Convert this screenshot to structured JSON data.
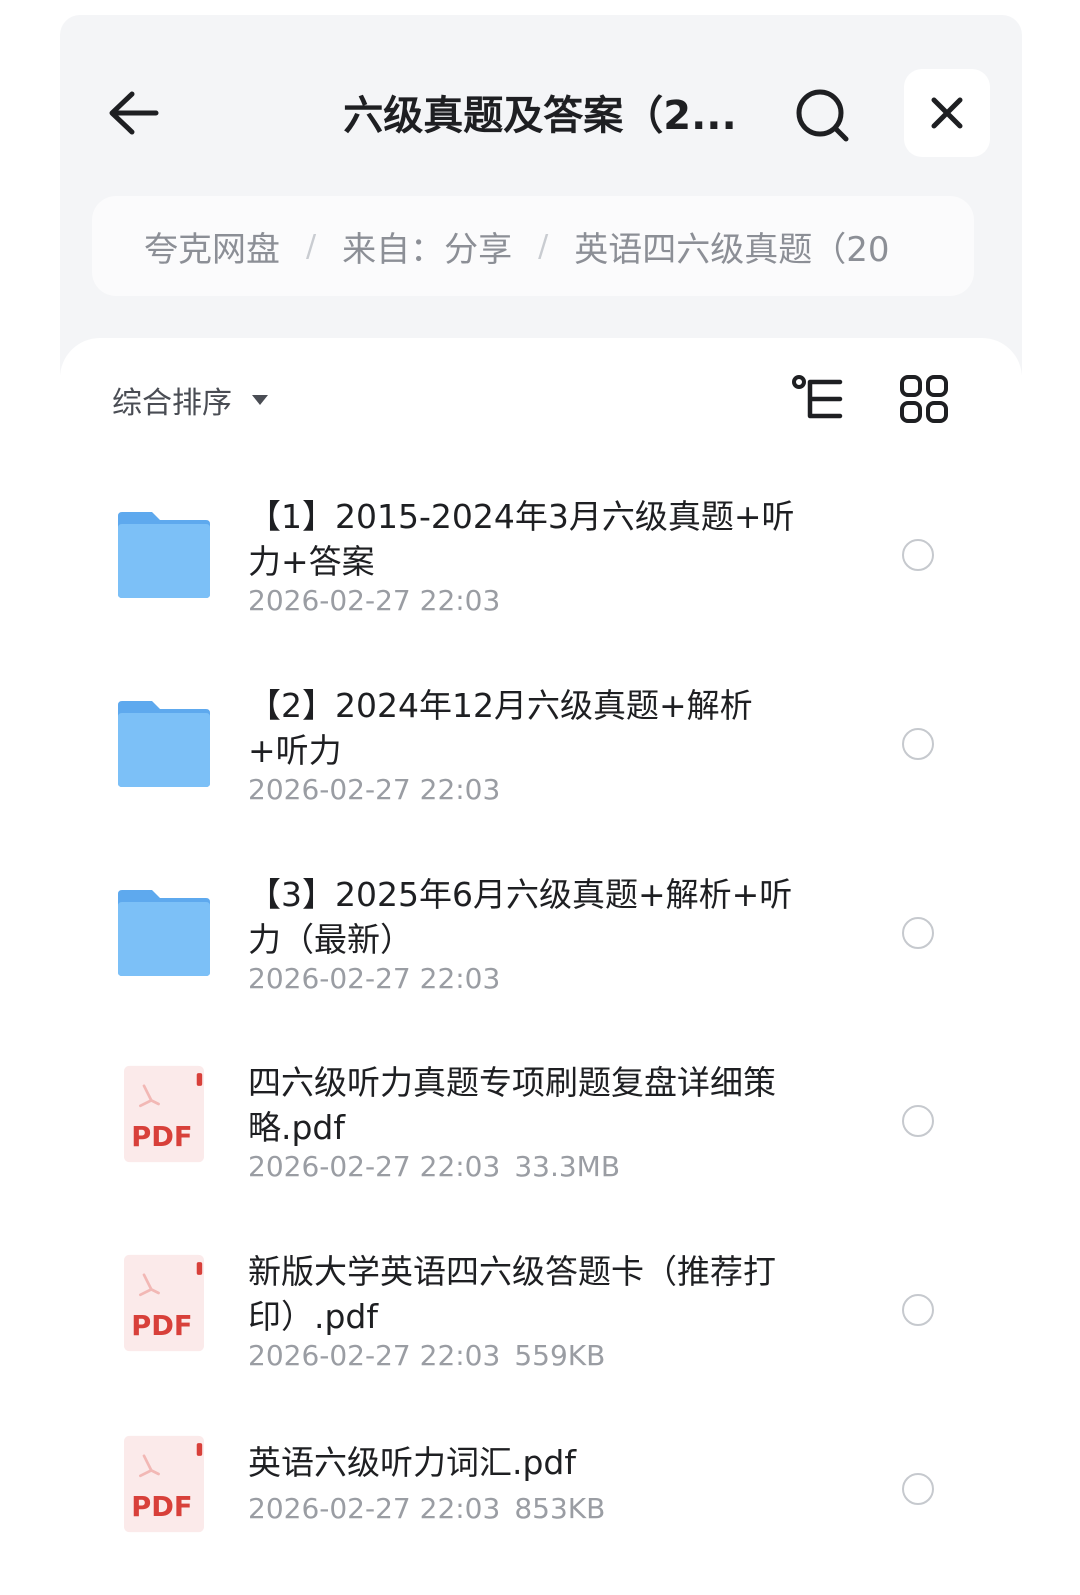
{
  "header": {
    "title": "六级真题及答案（2...",
    "back_icon": "arrow-left-icon",
    "search_icon": "search-icon",
    "close_icon": "close-icon"
  },
  "breadcrumb": {
    "items": [
      "夸克网盘",
      "来自：分享",
      "英语四六级真题（20"
    ],
    "separator": "/"
  },
  "toolbar": {
    "sort_label": "综合排序",
    "tree_icon": "tree-view-icon",
    "grid_icon": "grid-view-icon"
  },
  "files": [
    {
      "type": "folder",
      "name": "【1】2015-2024年3月六级真题+听力+答案",
      "date": "2026-02-27 22:03",
      "size": ""
    },
    {
      "type": "folder",
      "name": "【2】2024年12月六级真题+解析+听力",
      "date": "2026-02-27 22:03",
      "size": ""
    },
    {
      "type": "folder",
      "name": "【3】2025年6月六级真题+解析+听力（最新）",
      "date": "2026-02-27 22:03",
      "size": ""
    },
    {
      "type": "pdf",
      "name": "四六级听力真题专项刷题复盘详细策略.pdf",
      "date": "2026-02-27 22:03",
      "size": "33.3MB",
      "badge": "PDF"
    },
    {
      "type": "pdf",
      "name": "新版大学英语四六级答题卡（推荐打印）.pdf",
      "date": "2026-02-27 22:03",
      "size": "559KB",
      "badge": "PDF"
    },
    {
      "type": "pdf",
      "name": "英语六级听力词汇.pdf",
      "date": "2026-02-27 22:03",
      "size": "853KB",
      "badge": "PDF"
    }
  ],
  "colors": {
    "folder": "#6fb6f3",
    "pdf_badge": "#d8403a",
    "title": "#1e1f22",
    "meta": "#9a9da3"
  }
}
